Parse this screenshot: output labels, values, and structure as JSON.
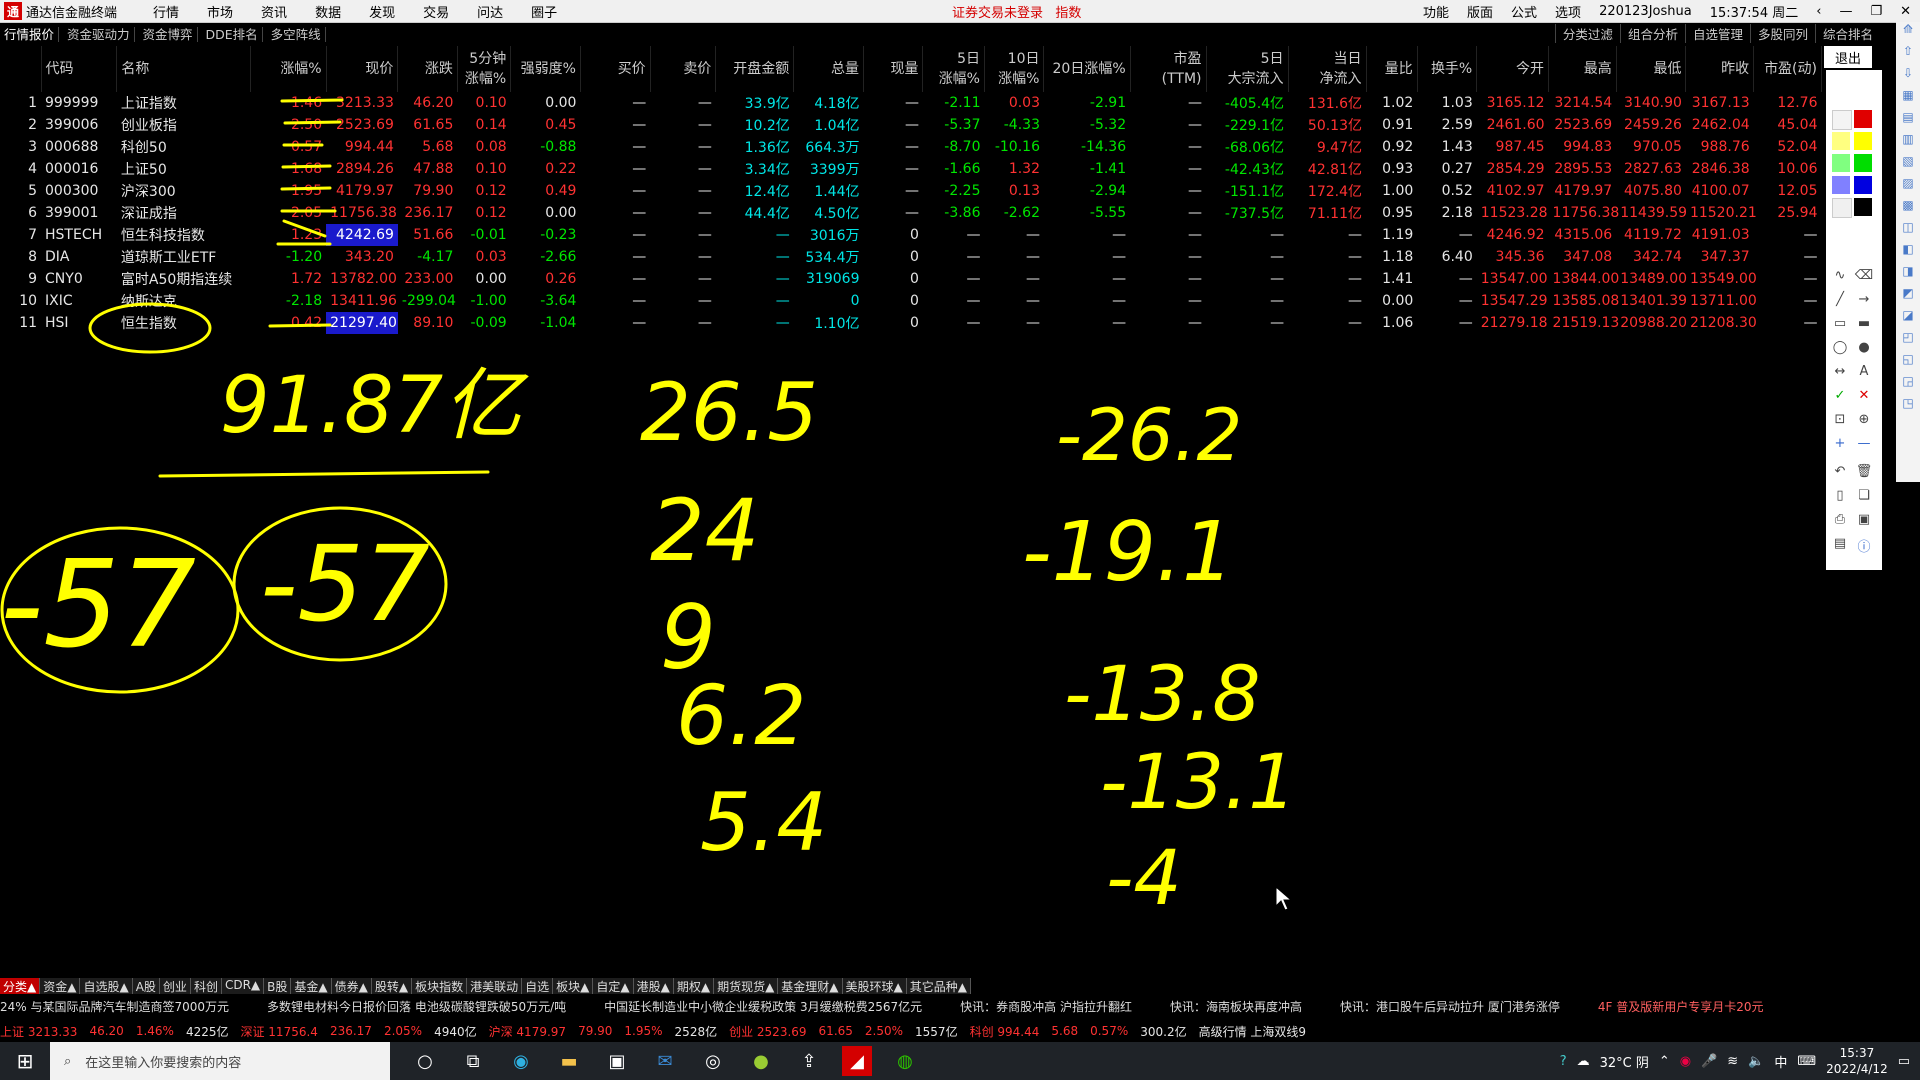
{
  "titlebar": {
    "app_title": "通达信金融终端",
    "menu": [
      "行情",
      "市场",
      "资讯",
      "数据",
      "发现",
      "交易",
      "问达",
      "圈子"
    ],
    "center_status": "证券交易未登录",
    "center_mode": "指数",
    "right_items": [
      "功能",
      "版面",
      "公式",
      "选项",
      "220123Joshua",
      "15:37:54 周二"
    ]
  },
  "tabs": {
    "left": [
      "行情报价",
      "资金驱动力",
      "资金博弈",
      "DDE排名",
      "多空阵线"
    ],
    "right": [
      "分类过滤",
      "组合分析",
      "自选管理",
      "多股同列",
      "综合排名"
    ]
  },
  "exit_label": "退出",
  "table": {
    "headers": [
      "",
      "代码",
      "名称",
      "涨幅%",
      "现价",
      "涨跌",
      "5分钟\n涨幅%",
      "强弱度%",
      "买价",
      "卖价",
      "开盘金额",
      "总量",
      "现量",
      "5日\n涨幅%",
      "10日\n涨幅%",
      "20日涨幅%",
      "市盈(TTM)",
      "5日\n大宗流入",
      "当日\n净流入",
      "量比",
      "换手%",
      "今开",
      "最高",
      "最低",
      "昨收",
      "市盈(动)"
    ],
    "rows": [
      [
        "1",
        "999999",
        "上证指数",
        "1.46",
        "3213.33",
        "46.20",
        "0.10",
        "0.00",
        "—",
        "—",
        "33.9亿",
        "4.18亿",
        "—",
        "-2.11",
        "0.03",
        "-2.91",
        "—",
        "-405.4亿",
        "131.6亿",
        "1.02",
        "1.03",
        "3165.12",
        "3214.54",
        "3140.90",
        "3167.13",
        "12.76"
      ],
      [
        "2",
        "399006",
        "创业板指",
        "2.50",
        "2523.69",
        "61.65",
        "0.14",
        "0.45",
        "—",
        "—",
        "10.2亿",
        "1.04亿",
        "—",
        "-5.37",
        "-4.33",
        "-5.32",
        "—",
        "-229.1亿",
        "50.13亿",
        "0.91",
        "2.59",
        "2461.60",
        "2523.69",
        "2459.26",
        "2462.04",
        "45.04"
      ],
      [
        "3",
        "000688",
        "科创50",
        "0.57",
        "994.44",
        "5.68",
        "0.08",
        "-0.88",
        "—",
        "—",
        "1.36亿",
        "664.3万",
        "—",
        "-8.70",
        "-10.16",
        "-14.36",
        "—",
        "-68.06亿",
        "9.47亿",
        "0.92",
        "1.43",
        "987.45",
        "994.83",
        "970.05",
        "988.76",
        "52.04"
      ],
      [
        "4",
        "000016",
        "上证50",
        "1.68",
        "2894.26",
        "47.88",
        "0.10",
        "0.22",
        "—",
        "—",
        "3.34亿",
        "3399万",
        "—",
        "-1.66",
        "1.32",
        "-1.41",
        "—",
        "-42.43亿",
        "42.81亿",
        "0.93",
        "0.27",
        "2854.29",
        "2895.53",
        "2827.63",
        "2846.38",
        "10.06"
      ],
      [
        "5",
        "000300",
        "沪深300",
        "1.95",
        "4179.97",
        "79.90",
        "0.12",
        "0.49",
        "—",
        "—",
        "12.4亿",
        "1.44亿",
        "—",
        "-2.25",
        "0.13",
        "-2.94",
        "—",
        "-151.1亿",
        "172.4亿",
        "1.00",
        "0.52",
        "4102.97",
        "4179.97",
        "4075.80",
        "4100.07",
        "12.05"
      ],
      [
        "6",
        "399001",
        "深证成指",
        "2.05",
        "11756.38",
        "236.17",
        "0.12",
        "0.00",
        "—",
        "—",
        "44.4亿",
        "4.50亿",
        "—",
        "-3.86",
        "-2.62",
        "-5.55",
        "—",
        "-737.5亿",
        "71.11亿",
        "0.95",
        "2.18",
        "11523.28",
        "11756.38",
        "11439.59",
        "11520.21",
        "25.94"
      ],
      [
        "7",
        "HSTECH",
        "恒生科技指数",
        "1.23",
        "4242.69",
        "51.66",
        "-0.01",
        "-0.23",
        "—",
        "—",
        "—",
        "3016万",
        "0",
        "—",
        "—",
        "—",
        "—",
        "—",
        "—",
        "1.19",
        "—",
        "4246.92",
        "4315.06",
        "4119.72",
        "4191.03",
        "—"
      ],
      [
        "8",
        "DIA",
        "道琼斯工业ETF",
        "-1.20",
        "343.20",
        "-4.17",
        "0.03",
        "-2.66",
        "—",
        "—",
        "—",
        "534.4万",
        "0",
        "—",
        "—",
        "—",
        "—",
        "—",
        "—",
        "1.18",
        "6.40",
        "345.36",
        "347.08",
        "342.74",
        "347.37",
        "—"
      ],
      [
        "9",
        "CNY0",
        "富时A50期指连续",
        "1.72",
        "13782.00",
        "233.00",
        "0.00",
        "0.26",
        "—",
        "—",
        "—",
        "319069",
        "0",
        "—",
        "—",
        "—",
        "—",
        "—",
        "—",
        "1.41",
        "—",
        "13547.00",
        "13844.00",
        "13489.00",
        "13549.00",
        "—"
      ],
      [
        "10",
        "IXIC",
        "纳斯达克",
        "-2.18",
        "13411.96",
        "-299.04",
        "-1.00",
        "-3.64",
        "—",
        "—",
        "—",
        "0",
        "0",
        "—",
        "—",
        "—",
        "—",
        "—",
        "—",
        "0.00",
        "—",
        "13547.29",
        "13585.08",
        "13401.39",
        "13711.00",
        "—"
      ],
      [
        "11",
        "HSI",
        "恒生指数",
        "0.42",
        "21297.40",
        "89.10",
        "-0.09",
        "-1.04",
        "—",
        "—",
        "—",
        "1.10亿",
        "0",
        "—",
        "—",
        "—",
        "—",
        "—",
        "—",
        "1.06",
        "—",
        "21279.18",
        "21519.13",
        "20988.20",
        "21208.30",
        "—"
      ]
    ]
  },
  "handwriting": {
    "total": "91.87亿",
    "circle_left": "-57",
    "circle_right": "-57",
    "col2": [
      "26.5",
      "24",
      "9",
      "6.2",
      "5.4"
    ],
    "col3": [
      "-26.2",
      "-19.1",
      "-13.8",
      "-13.1",
      "-4"
    ]
  },
  "category_tabs": [
    "分类▲",
    "资金▲",
    "自选股▲",
    "A股",
    "创业",
    "科创",
    "CDR▲",
    "B股",
    "基金▲",
    "债券▲",
    "股转▲",
    "板块指数",
    "港美联动",
    "自选",
    "板块▲",
    "自定▲",
    "港股▲",
    "期权▲",
    "期货现货▲",
    "基金理财▲",
    "美股环球▲",
    "其它品种▲"
  ],
  "ticker": [
    "24% 与某国际品牌汽车制造商签7000万元",
    "多数锂电材料今日报价回落 电池级碳酸锂跌破50万元/吨",
    "中国延长制造业中小微企业缓税政策 3月缓缴税费2567亿元",
    "快讯：券商股冲高 沪指拉升翻红",
    "快讯：海南板块再度冲高",
    "快讯：港口股午后异动拉升 厦门港务涨停",
    "4F 普及版新用户专享月卡20元"
  ],
  "stats": [
    {
      "text": "上证 3213.33",
      "cls": "r"
    },
    {
      "text": "46.20",
      "cls": "r"
    },
    {
      "text": "1.46%",
      "cls": "r"
    },
    {
      "text": "4225亿",
      "cls": "w"
    },
    {
      "text": "深证 11756.4",
      "cls": "r"
    },
    {
      "text": "236.17",
      "cls": "r"
    },
    {
      "text": "2.05%",
      "cls": "r"
    },
    {
      "text": "4940亿",
      "cls": "w"
    },
    {
      "text": "沪深 4179.97",
      "cls": "r"
    },
    {
      "text": "79.90",
      "cls": "r"
    },
    {
      "text": "1.95%",
      "cls": "r"
    },
    {
      "text": "2528亿",
      "cls": "w"
    },
    {
      "text": "创业 2523.69",
      "cls": "r"
    },
    {
      "text": "61.65",
      "cls": "r"
    },
    {
      "text": "2.50%",
      "cls": "r"
    },
    {
      "text": "1557亿",
      "cls": "w"
    },
    {
      "text": "科创 994.44",
      "cls": "r"
    },
    {
      "text": "5.68",
      "cls": "r"
    },
    {
      "text": "0.57%",
      "cls": "r"
    },
    {
      "text": "300.2亿",
      "cls": "w"
    },
    {
      "text": "高级行情 上海双线9",
      "cls": "w"
    }
  ],
  "taskbar": {
    "search_placeholder": "在这里输入你要搜索的内容",
    "weather": "32°C 阴",
    "ime": "中",
    "time": "15:37",
    "date": "2022/4/12"
  }
}
